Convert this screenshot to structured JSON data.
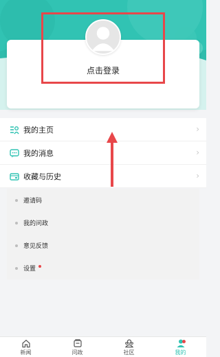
{
  "colors": {
    "accent": "#31c3b3",
    "highlight_red": "#e8474a",
    "background": "#f3f4f6"
  },
  "profile": {
    "login_text": "点击登录",
    "avatar_icon": "default-user-avatar"
  },
  "menu": {
    "items": [
      {
        "label": "我的主页",
        "icon": "home-profile-icon"
      },
      {
        "label": "我的消息",
        "icon": "message-icon"
      },
      {
        "label": "收藏与历史",
        "icon": "favorites-history-icon"
      }
    ]
  },
  "submenu": {
    "items": [
      {
        "label": "邀请码"
      },
      {
        "label": "我的问政"
      },
      {
        "label": "意见反馈"
      },
      {
        "label": "设置",
        "has_badge": true
      }
    ]
  },
  "tabbar": {
    "tabs": [
      {
        "label": "新闻",
        "icon": "home-icon",
        "active": false
      },
      {
        "label": "问政",
        "icon": "inquiry-icon",
        "active": false
      },
      {
        "label": "社区",
        "icon": "community-icon",
        "active": false
      },
      {
        "label": "我的",
        "icon": "user-icon",
        "active": true
      }
    ]
  }
}
